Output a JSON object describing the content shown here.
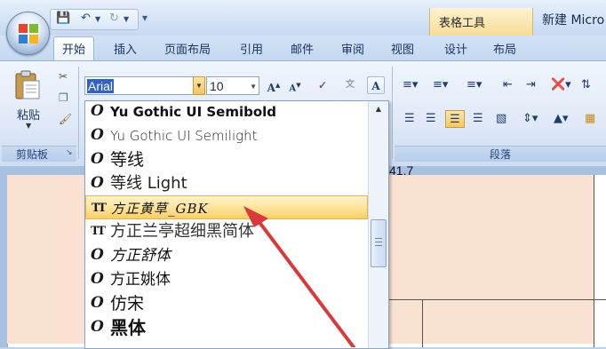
{
  "titlebar": {
    "context_tab_title": "表格工具",
    "document_title": "新建 Micro",
    "qat": {
      "save_icon": "save-icon",
      "undo_icon": "undo-icon",
      "redo_icon": "redo-icon"
    }
  },
  "tabs": [
    {
      "label": "开始",
      "active": true
    },
    {
      "label": "插入"
    },
    {
      "label": "页面布局"
    },
    {
      "label": "引用"
    },
    {
      "label": "邮件"
    },
    {
      "label": "审阅"
    },
    {
      "label": "视图"
    },
    {
      "label": "设计"
    },
    {
      "label": "布局"
    }
  ],
  "ribbon": {
    "clipboard": {
      "paste_label": "粘贴",
      "caption": "剪贴板"
    },
    "font": {
      "name_value": "Arial",
      "size_value": "10",
      "grow_label": "A",
      "shrink_label": "A",
      "clear_label": "A"
    },
    "paragraph": {
      "caption": "段落"
    }
  },
  "font_list": [
    {
      "name": "Yu Gothic UI Semibold",
      "type": "opentype"
    },
    {
      "name": "Yu Gothic UI Semilight",
      "type": "opentype"
    },
    {
      "name": "等线",
      "type": "opentype"
    },
    {
      "name": "等线 Light",
      "type": "opentype"
    },
    {
      "name": "方正黄草_GBK",
      "type": "truetype",
      "hovered": true
    },
    {
      "name": "方正兰亭超细黑简体",
      "type": "truetype"
    },
    {
      "name": "方正舒体",
      "type": "opentype"
    },
    {
      "name": "方正姚体",
      "type": "opentype"
    },
    {
      "name": "仿宋",
      "type": "opentype"
    },
    {
      "name": "黑体",
      "type": "opentype"
    }
  ],
  "document": {
    "cell_value": "41.7"
  },
  "colors": {
    "hover_row": "#fde29a",
    "accent": "#3163c5",
    "arrow": "#d9393a"
  }
}
